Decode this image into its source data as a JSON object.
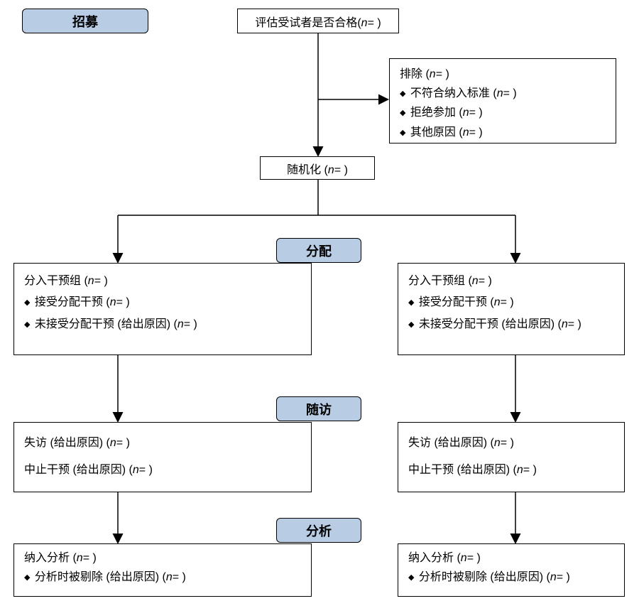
{
  "phases": {
    "enrollment": "招募",
    "allocation": "分配",
    "followup": "随访",
    "analysis": "分析"
  },
  "top": {
    "eligibility_pre": "评估受试者是否合格(",
    "eligibility_n": "n",
    "eligibility_post": "=   )",
    "excluded_title_pre": "排除 (",
    "excluded_title_n": "n",
    "excluded_title_post": "=   )",
    "excluded_item1_pre": "不符合纳入标准 (",
    "excluded_item1_n": "n",
    "excluded_item1_post": "=   )",
    "excluded_item2_pre": "拒绝参加 (",
    "excluded_item2_n": "n",
    "excluded_item2_post": "=   )",
    "excluded_item3_pre": "其他原因 (",
    "excluded_item3_n": "n",
    "excluded_item3_post": "=   )",
    "randomized_pre": "随机化 (",
    "randomized_n": "n",
    "randomized_post": "=   )"
  },
  "alloc_left": {
    "line1_pre": "分入干预组 (",
    "line1_n": "n",
    "line1_post": "=   )",
    "line2_pre": "接受分配干预 (",
    "line2_n": "n",
    "line2_post": "=   )",
    "line3_pre": "未接受分配干预 (给出原因) (",
    "line3_n": "n",
    "line3_post": "=   )"
  },
  "alloc_right": {
    "line1_pre": "分入干预组 (",
    "line1_n": "n",
    "line1_post": "=   )",
    "line2_pre": "接受分配干预 (",
    "line2_n": "n",
    "line2_post": "=   )",
    "line3_pre": "未接受分配干预 (给出原因) (",
    "line3_n": "n",
    "line3_post": "=   )"
  },
  "fu_left": {
    "line1_pre": "失访 (给出原因) (",
    "line1_n": "n",
    "line1_post": "=   )",
    "line2_pre": "中止干预 (给出原因) (",
    "line2_n": "n",
    "line2_post": "=   )"
  },
  "fu_right": {
    "line1_pre": "失访 (给出原因) (",
    "line1_n": "n",
    "line1_post": "=   )",
    "line2_pre": "中止干预 (给出原因) (",
    "line2_n": "n",
    "line2_post": "=   )"
  },
  "an_left": {
    "line1_pre": "纳入分析 (",
    "line1_n": "n",
    "line1_post": "=   )",
    "line2_pre": "分析时被剔除 (给出原因) (",
    "line2_n": "n",
    "line2_post": "=   )"
  },
  "an_right": {
    "line1_pre": "纳入分析 (",
    "line1_n": "n",
    "line1_post": "=   )",
    "line2_pre": "分析时被剔除 (给出原因) (",
    "line2_n": "n",
    "line2_post": "=   )"
  }
}
